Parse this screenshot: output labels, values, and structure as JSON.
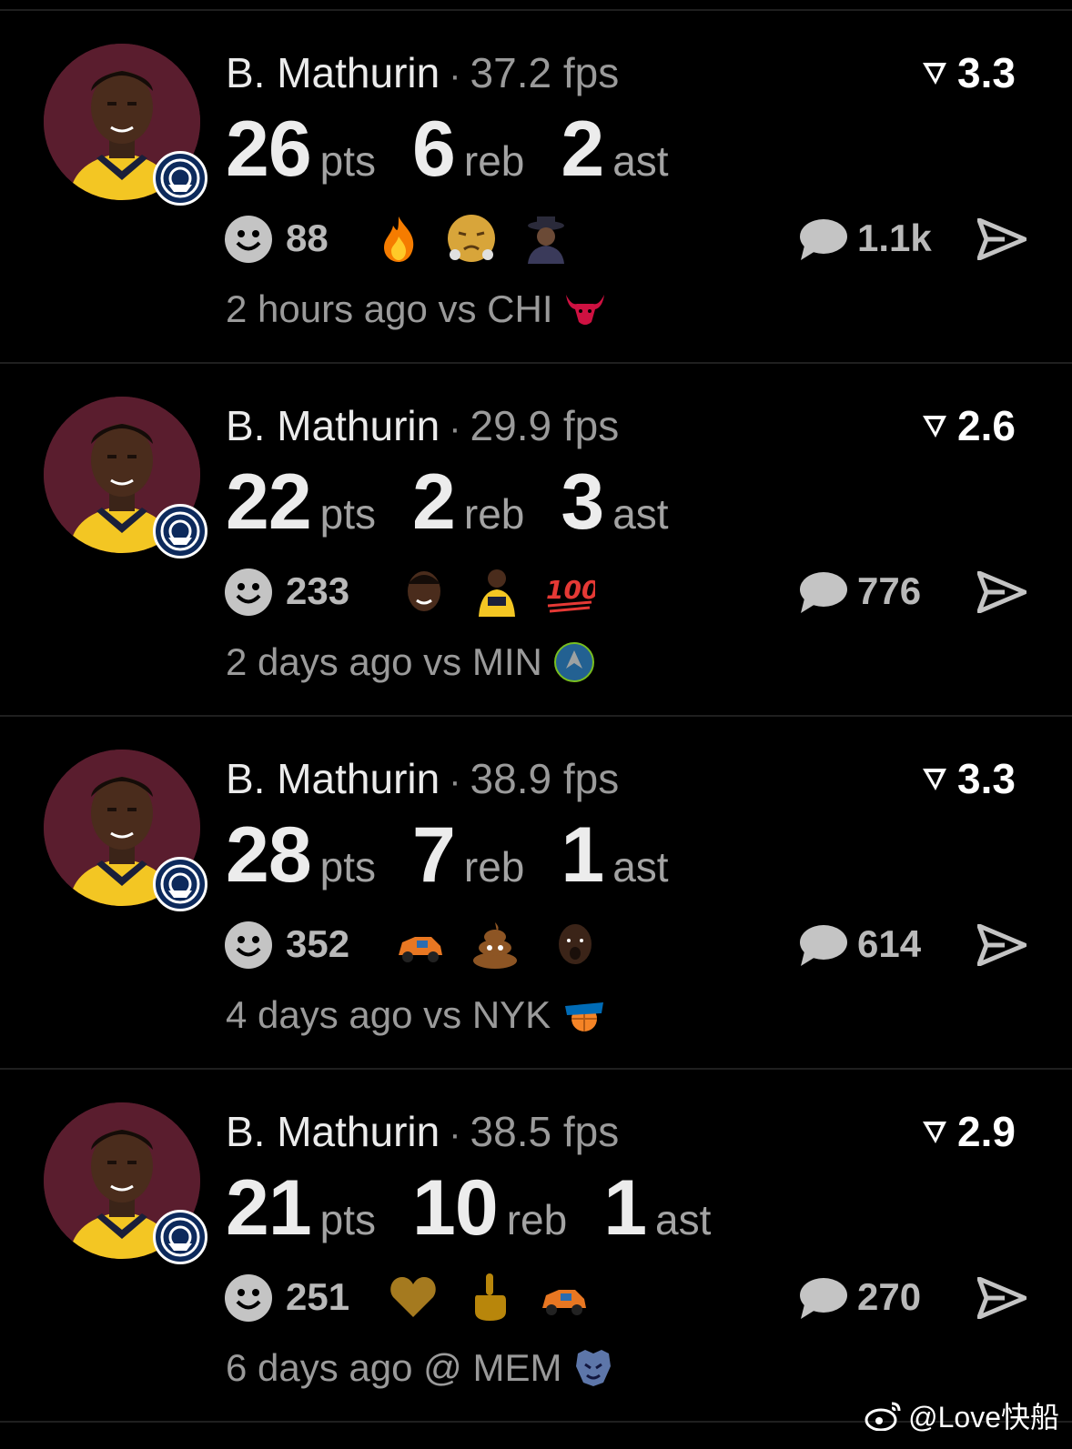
{
  "cards": [
    {
      "player_name": "B. Mathurin",
      "fps": "37.2 fps",
      "rating": "3.3",
      "stats": [
        {
          "value": "26",
          "unit": "pts"
        },
        {
          "value": "6",
          "unit": "reb"
        },
        {
          "value": "2",
          "unit": "ast"
        }
      ],
      "reaction_count": "88",
      "reaction_emojis": [
        "fire-emoji",
        "steam-nose-emoji",
        "hat-person-sticker"
      ],
      "comment_count": "1.1k",
      "time_text": "2 hours ago vs CHI",
      "opponent_logo": "bulls-logo"
    },
    {
      "player_name": "B. Mathurin",
      "fps": "29.9 fps",
      "rating": "2.6",
      "stats": [
        {
          "value": "22",
          "unit": "pts"
        },
        {
          "value": "2",
          "unit": "reb"
        },
        {
          "value": "3",
          "unit": "ast"
        }
      ],
      "reaction_count": "233",
      "reaction_emojis": [
        "player-face-sticker",
        "player-jersey-sticker",
        "hundred-emoji"
      ],
      "comment_count": "776",
      "time_text": "2 days ago vs MIN",
      "opponent_logo": "timberwolves-logo"
    },
    {
      "player_name": "B. Mathurin",
      "fps": "38.9 fps",
      "rating": "3.3",
      "stats": [
        {
          "value": "28",
          "unit": "pts"
        },
        {
          "value": "7",
          "unit": "reb"
        },
        {
          "value": "1",
          "unit": "ast"
        }
      ],
      "reaction_count": "352",
      "reaction_emojis": [
        "race-car-emoji",
        "poop-emoji",
        "player-face-sticker"
      ],
      "comment_count": "614",
      "time_text": "4 days ago vs NYK",
      "opponent_logo": "knicks-logo"
    },
    {
      "player_name": "B. Mathurin",
      "fps": "38.5 fps",
      "rating": "2.9",
      "stats": [
        {
          "value": "21",
          "unit": "pts"
        },
        {
          "value": "10",
          "unit": "reb"
        },
        {
          "value": "1",
          "unit": "ast"
        }
      ],
      "reaction_count": "251",
      "reaction_emojis": [
        "gold-heart-emoji",
        "middle-finger-emoji",
        "race-car-emoji"
      ],
      "comment_count": "270",
      "time_text": "6 days ago @ MEM",
      "opponent_logo": "grizzlies-logo"
    }
  ],
  "watermark": {
    "text": "@Love快船",
    "icon": "weibo-icon"
  },
  "colors": {
    "background": "#000000",
    "avatar_bg": "#5a1d2e",
    "muted_text": "#9a9a9a",
    "primary_text": "#ececec"
  }
}
